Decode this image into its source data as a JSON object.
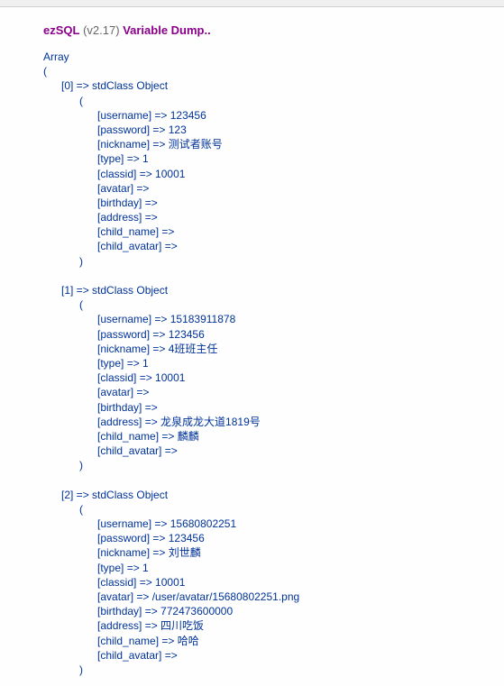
{
  "header": {
    "brand": "ezSQL",
    "version": "(v2.17)",
    "label": "Variable Dump.."
  },
  "root_label": "Array",
  "open_paren": "(",
  "close_paren": ")",
  "class_label": "stdClass Object",
  "items": [
    {
      "index": "[0]",
      "fields": [
        {
          "key": "[username]",
          "value": "123456"
        },
        {
          "key": "[password]",
          "value": "123"
        },
        {
          "key": "[nickname]",
          "value": "测试者账号"
        },
        {
          "key": "[type]",
          "value": "1"
        },
        {
          "key": "[classid]",
          "value": "10001"
        },
        {
          "key": "[avatar]",
          "value": ""
        },
        {
          "key": "[birthday]",
          "value": ""
        },
        {
          "key": "[address]",
          "value": ""
        },
        {
          "key": "[child_name]",
          "value": ""
        },
        {
          "key": "[child_avatar]",
          "value": ""
        }
      ]
    },
    {
      "index": "[1]",
      "fields": [
        {
          "key": "[username]",
          "value": "15183911878"
        },
        {
          "key": "[password]",
          "value": "123456"
        },
        {
          "key": "[nickname]",
          "value": "4班班主任"
        },
        {
          "key": "[type]",
          "value": "1"
        },
        {
          "key": "[classid]",
          "value": "10001"
        },
        {
          "key": "[avatar]",
          "value": ""
        },
        {
          "key": "[birthday]",
          "value": ""
        },
        {
          "key": "[address]",
          "value": "龙泉成龙大道1819号"
        },
        {
          "key": "[child_name]",
          "value": "麟麟"
        },
        {
          "key": "[child_avatar]",
          "value": ""
        }
      ]
    },
    {
      "index": "[2]",
      "fields": [
        {
          "key": "[username]",
          "value": "15680802251"
        },
        {
          "key": "[password]",
          "value": "123456"
        },
        {
          "key": "[nickname]",
          "value": "刘世麟"
        },
        {
          "key": "[type]",
          "value": "1"
        },
        {
          "key": "[classid]",
          "value": "10001"
        },
        {
          "key": "[avatar]",
          "value": "/user/avatar/15680802251.png"
        },
        {
          "key": "[birthday]",
          "value": "772473600000"
        },
        {
          "key": "[address]",
          "value": "四川吃饭"
        },
        {
          "key": "[child_name]",
          "value": "哈哈"
        },
        {
          "key": "[child_avatar]",
          "value": ""
        }
      ]
    }
  ]
}
